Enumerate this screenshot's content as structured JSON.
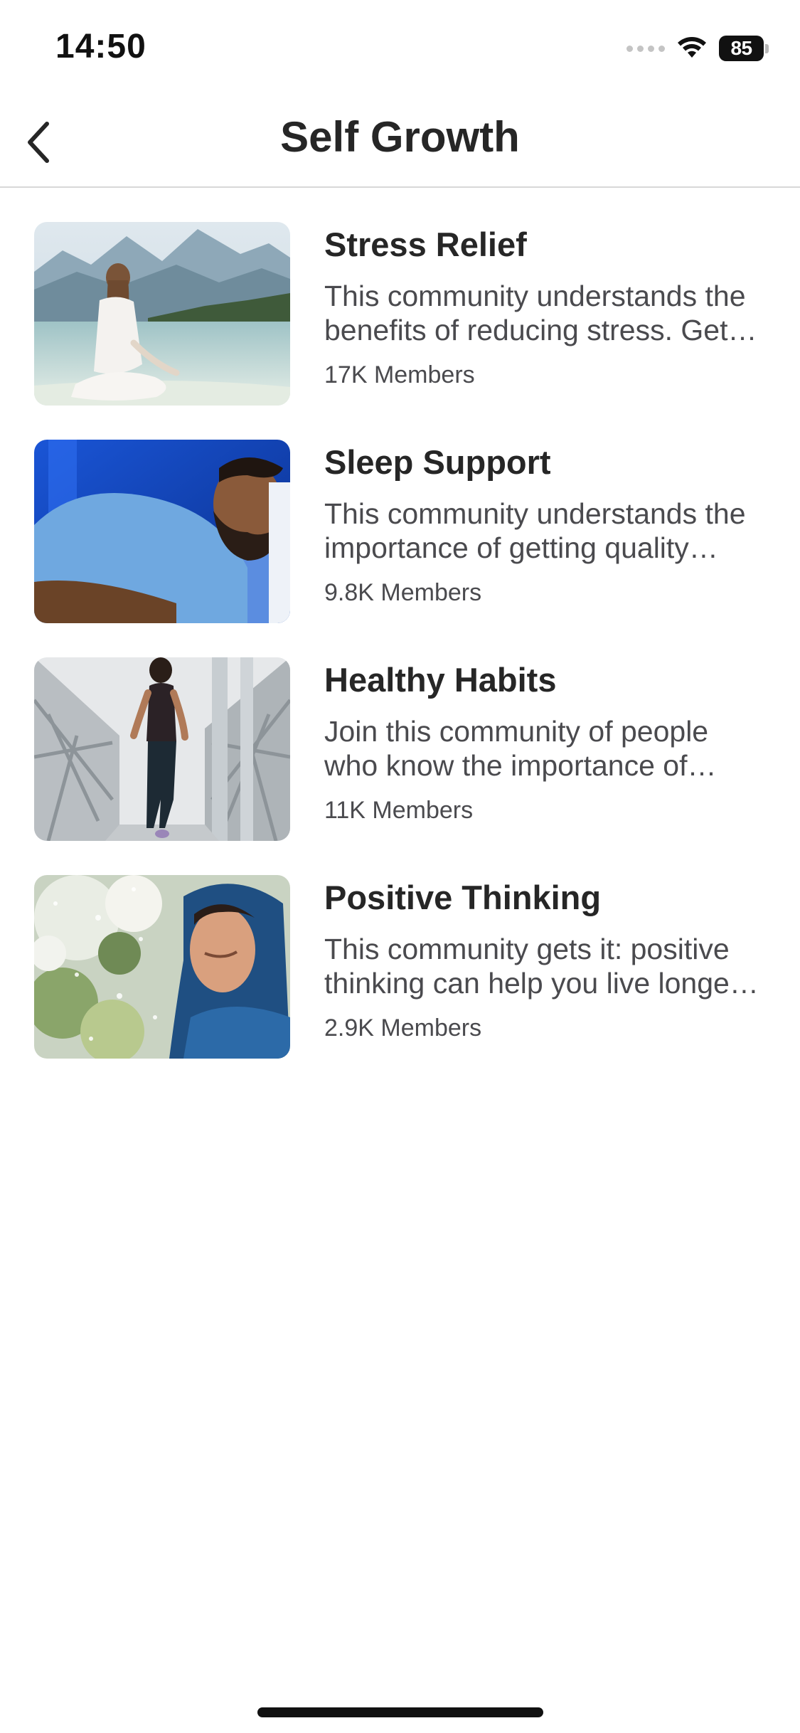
{
  "status_bar": {
    "time": "14:50",
    "battery_level": "85",
    "wifi_icon": "wifi-icon",
    "cell_icon": "cellular-signal-icon"
  },
  "nav": {
    "title": "Self Growth",
    "back_icon": "chevron-left-icon"
  },
  "communities": [
    {
      "title": "Stress Relief",
      "description": "This community understands the benefits of reducing stress. Get support and tips",
      "members": "17K Members",
      "image": "woman-meditating-by-lake-image"
    },
    {
      "title": "Sleep Support",
      "description": "This community understands the importance of getting quality sleep every night",
      "members": "9.8K Members",
      "image": "man-sleeping-on-pillow-image"
    },
    {
      "title": "Healthy Habits",
      "description": "Join this community of people who know the importance of everyday healthy habits",
      "members": "11K Members",
      "image": "woman-running-on-bridge-image"
    },
    {
      "title": "Positive Thinking",
      "description": "This community gets it: positive thinking can help you live longer and happier",
      "members": "2.9K Members",
      "image": "man-smiling-in-rain-image"
    }
  ],
  "colors": {
    "text_primary": "#262626",
    "text_secondary": "#4a4a4e",
    "divider": "#d8d8d8",
    "background": "#ffffff"
  }
}
